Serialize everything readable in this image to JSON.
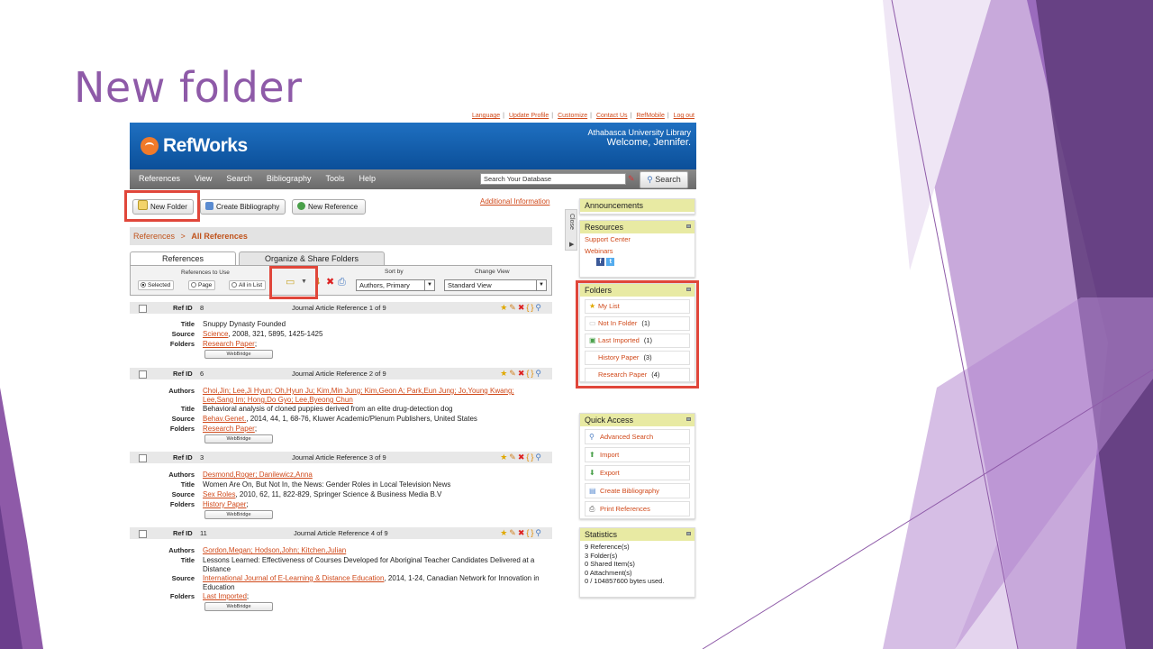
{
  "slide": {
    "title": "New folder"
  },
  "colors": {
    "accent_purple": "#8e5aa8",
    "link_orange": "#d0491a",
    "banner_blue": "#1560b0",
    "highlight_red": "#e0463a"
  },
  "top_links": [
    "Language",
    "Update Profile",
    "Customize",
    "Contact Us",
    "RefMobile",
    "Log out"
  ],
  "banner": {
    "logo_text": "RefWorks",
    "institution": "Athabasca University Library",
    "welcome": "Welcome, Jennifer."
  },
  "nav": {
    "items": [
      "References",
      "View",
      "Search",
      "Bibliography",
      "Tools",
      "Help"
    ]
  },
  "search": {
    "placeholder": "Search Your Database",
    "button": "Search"
  },
  "action_buttons": {
    "new_folder": "New Folder",
    "create_bibliography": "Create Bibliography",
    "new_reference": "New Reference"
  },
  "additional_info": "Additional Information",
  "breadcrumb": {
    "root": "References",
    "sep": ">",
    "current": "All References"
  },
  "tabs": [
    "References",
    "Organize & Share Folders"
  ],
  "toolbar": {
    "refs_to_use": "References to Use",
    "options": [
      "Selected",
      "Page",
      "All in List"
    ],
    "sort_by_label": "Sort by",
    "sort_by_value": "Authors, Primary",
    "change_view_label": "Change View",
    "view_value": "Standard View"
  },
  "references": [
    {
      "ref_id_label": "Ref ID",
      "ref_id": "8",
      "type": "Journal Article Reference 1 of 9",
      "title": "Snuppy Dynasty Founded",
      "source_link": "Science",
      "source_rest": ", 2008, 321, 5895, 1425-1425",
      "folders": "Research Paper",
      "webbridge": "WebBridge"
    },
    {
      "ref_id_label": "Ref ID",
      "ref_id": "6",
      "type": "Journal Article Reference 2 of 9",
      "authors_line1": "Choi,Jin; Lee,Ji Hyun; Oh,Hyun Ju; Kim,Min Jung; Kim,Geon A; Park,Eun Jung; Jo,Young Kwang;",
      "authors_line2": "Lee,Sang Im; Hong,Do Gyo; Lee,Byeong Chun",
      "title": "Behavioral analysis of cloned puppies derived from an elite drug-detection dog",
      "source_link": "Behav.Genet.",
      "source_rest": ", 2014, 44, 1, 68-76, Kluwer Academic/Plenum Publishers, United States",
      "folders": "Research Paper",
      "webbridge": "WebBridge"
    },
    {
      "ref_id_label": "Ref ID",
      "ref_id": "3",
      "type": "Journal Article Reference 3 of 9",
      "authors_line1": "Desmond,Roger; Danilewicz,Anna",
      "title": "Women Are On, But Not In, the News: Gender Roles in Local Television News",
      "source_link": "Sex Roles",
      "source_rest": ", 2010, 62, 11, 822-829, Springer Science & Business Media B.V",
      "folders": "History Paper",
      "webbridge": "WebBridge"
    },
    {
      "ref_id_label": "Ref ID",
      "ref_id": "11",
      "type": "Journal Article Reference 4 of 9",
      "authors_line1": "Gordon,Megan; Hodson,John; Kitchen,Julian",
      "title_line1": "Lessons Learned: Effectiveness of Courses Developed for Aboriginal Teacher Candidates Delivered at a",
      "title_line2": "Distance",
      "source_link": "International Journal of E-Learning & Distance Education",
      "source_rest": ", 2014, 1-24, Canadian Network for Innovation in",
      "source_line2": "Education",
      "folders": "Last Imported",
      "webbridge": "WebBridge"
    }
  ],
  "field_labels": {
    "title": "Title",
    "source": "Source",
    "folders": "Folders",
    "authors": "Authors"
  },
  "close_tab": "Close",
  "sidebar": {
    "announcements": "Announcements",
    "resources": {
      "title": "Resources",
      "links": [
        "Support Center",
        "Webinars"
      ]
    },
    "folders": {
      "title": "Folders",
      "items": [
        {
          "name": "My List",
          "count": ""
        },
        {
          "name": "Not In Folder",
          "count": "(1)"
        },
        {
          "name": "Last Imported",
          "count": "(1)"
        },
        {
          "name": "History Paper",
          "count": "(3)"
        },
        {
          "name": "Research Paper",
          "count": "(4)"
        }
      ]
    },
    "quick_access": {
      "title": "Quick Access",
      "items": [
        "Advanced Search",
        "Import",
        "Export",
        "Create Bibliography",
        "Print References"
      ]
    },
    "statistics": {
      "title": "Statistics",
      "lines": [
        "9 Reference(s)",
        "3 Folder(s)",
        "0 Shared Item(s)",
        "0 Attachment(s)",
        "0 / 104857600 bytes used."
      ]
    }
  }
}
